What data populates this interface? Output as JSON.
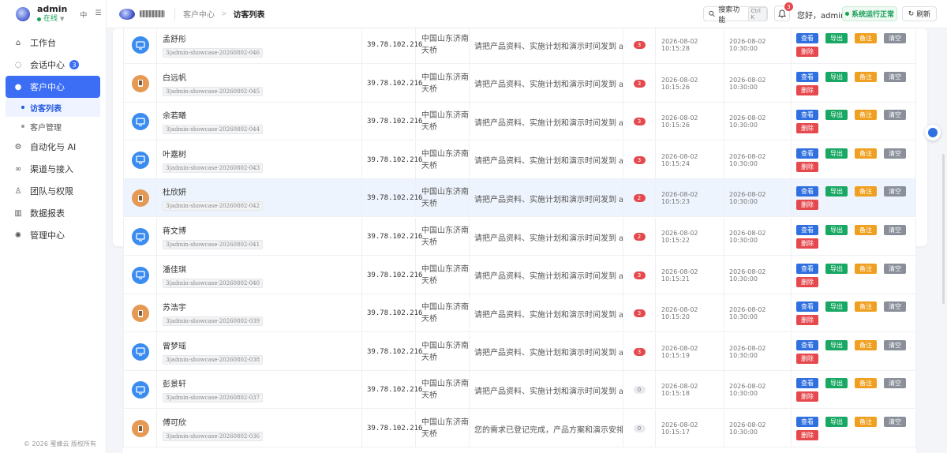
{
  "brand": {
    "name": "admin",
    "status": "在线",
    "lang": "中",
    "menu_icon": "hamburger-icon"
  },
  "sidebar": {
    "items": [
      {
        "label": "工作台",
        "icon": "home-icon"
      },
      {
        "label": "会话中心",
        "icon": "chat-icon",
        "badge": "3"
      },
      {
        "label": "客户中心",
        "icon": "user-icon",
        "active": true
      },
      {
        "label": "自动化与 AI",
        "icon": "gear-icon"
      },
      {
        "label": "渠道与接入",
        "icon": "link-icon"
      },
      {
        "label": "团队与权限",
        "icon": "person-icon"
      },
      {
        "label": "数据报表",
        "icon": "chart-icon"
      },
      {
        "label": "管理中心",
        "icon": "settings-icon"
      }
    ],
    "sub_items": [
      {
        "label": "访客列表",
        "active": true
      },
      {
        "label": "客户管理"
      }
    ],
    "copyright": "© 2026 蜜蜂云 版权所有"
  },
  "header": {
    "breadcrumb": [
      "客户中心",
      "访客列表"
    ],
    "search_label": "搜索功能",
    "search_kbd": "Ctrl K",
    "notif_count": "3",
    "greeting": "您好，admin",
    "system_status": "系统运行正常",
    "refresh_label": "刷新"
  },
  "actions": {
    "view": "查看",
    "export": "导出",
    "note": "备注",
    "clear": "清空",
    "delete": "删除"
  },
  "rows": [
    {
      "device": "pc",
      "name": "孟舒彤",
      "id": "3|admin-showcase-20260802-046",
      "ip": "39.78.102.216",
      "loc": "中国山东济南天桥",
      "msg": "请把产品资料、实施计划和演示时间发到 adm...",
      "count": "3",
      "t1": "2026-08-02 10:15:28",
      "t2": "2026-08-02 10:30:00"
    },
    {
      "device": "mob",
      "name": "白远帆",
      "id": "3|admin-showcase-20260802-045",
      "ip": "39.78.102.216",
      "loc": "中国山东济南天桥",
      "msg": "请把产品资料、实施计划和演示时间发到 adm...",
      "count": "3",
      "t1": "2026-08-02 10:15:26",
      "t2": "2026-08-02 10:30:00"
    },
    {
      "device": "pc",
      "name": "余若曦",
      "id": "3|admin-showcase-20260802-044",
      "ip": "39.78.102.216",
      "loc": "中国山东济南天桥",
      "msg": "请把产品资料、实施计划和演示时间发到 adm...",
      "count": "3",
      "t1": "2026-08-02 10:15:26",
      "t2": "2026-08-02 10:30:00"
    },
    {
      "device": "pc",
      "name": "叶嘉树",
      "id": "3|admin-showcase-20260802-043",
      "ip": "39.78.102.216",
      "loc": "中国山东济南天桥",
      "msg": "请把产品资料、实施计划和演示时间发到 adm...",
      "count": "3",
      "t1": "2026-08-02 10:15:24",
      "t2": "2026-08-02 10:30:00"
    },
    {
      "device": "mob",
      "name": "杜欣妍",
      "id": "3|admin-showcase-20260802-042",
      "ip": "39.78.102.216",
      "loc": "中国山东济南天桥",
      "msg": "请把产品资料、实施计划和演示时间发到 adm...",
      "count": "2",
      "t1": "2026-08-02 10:15:23",
      "t2": "2026-08-02 10:30:00",
      "hl": true
    },
    {
      "device": "pc",
      "name": "蒋文博",
      "id": "3|admin-showcase-20260802-041",
      "ip": "39.78.102.216",
      "loc": "中国山东济南天桥",
      "msg": "请把产品资料、实施计划和演示时间发到 adm...",
      "count": "2",
      "t1": "2026-08-02 10:15:22",
      "t2": "2026-08-02 10:30:00"
    },
    {
      "device": "pc",
      "name": "潘佳琪",
      "id": "3|admin-showcase-20260802-040",
      "ip": "39.78.102.216",
      "loc": "中国山东济南天桥",
      "msg": "请把产品资料、实施计划和演示时间发到 adm...",
      "count": "3",
      "t1": "2026-08-02 10:15:21",
      "t2": "2026-08-02 10:30:00"
    },
    {
      "device": "mob",
      "name": "苏浩宇",
      "id": "3|admin-showcase-20260802-039",
      "ip": "39.78.102.216",
      "loc": "中国山东济南天桥",
      "msg": "请把产品资料、实施计划和演示时间发到 adm...",
      "count": "3",
      "t1": "2026-08-02 10:15:20",
      "t2": "2026-08-02 10:30:00"
    },
    {
      "device": "pc",
      "name": "曾梦瑶",
      "id": "3|admin-showcase-20260802-038",
      "ip": "39.78.102.216",
      "loc": "中国山东济南天桥",
      "msg": "请把产品资料、实施计划和演示时间发到 adm...",
      "count": "3",
      "t1": "2026-08-02 10:15:19",
      "t2": "2026-08-02 10:30:00"
    },
    {
      "device": "pc",
      "name": "彭景轩",
      "id": "3|admin-showcase-20260802-037",
      "ip": "39.78.102.216",
      "loc": "中国山东济南天桥",
      "msg": "请把产品资料、实施计划和演示时间发到 adm...",
      "count": "0",
      "t1": "2026-08-02 10:15:18",
      "t2": "2026-08-02 10:30:00"
    },
    {
      "device": "mob",
      "name": "傅可欣",
      "id": "3|admin-showcase-20260802-036",
      "ip": "39.78.102.216",
      "loc": "中国山东济南天桥",
      "msg": "您的需求已登记完成，产品方案和演示安排会...",
      "count": "0",
      "t1": "2026-08-02 10:15:17",
      "t2": "2026-08-02 10:30:00"
    }
  ]
}
